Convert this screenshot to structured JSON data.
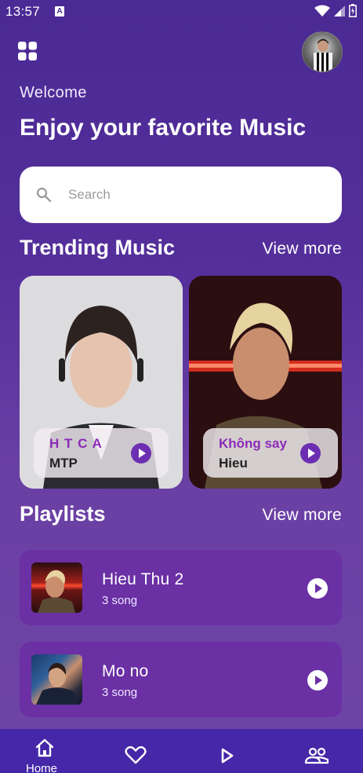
{
  "status_bar": {
    "time": "13:57",
    "notification_glyph": "A"
  },
  "header": {
    "menu_icon": "grid-icon",
    "avatar_icon": "profile-avatar"
  },
  "greeting": {
    "welcome": "Welcome",
    "headline": "Enjoy your favorite Music"
  },
  "search": {
    "placeholder": "Search"
  },
  "trending": {
    "title": "Trending Music",
    "view_more": "View more",
    "cards": [
      {
        "title": "H T C A",
        "artist": "MTP"
      },
      {
        "title": "Không say",
        "artist": "Hieu"
      }
    ]
  },
  "playlists": {
    "title": "Playlists",
    "view_more": "View more",
    "items": [
      {
        "name": "Hieu Thu 2",
        "count": "3 song"
      },
      {
        "name": "Mo no",
        "count": "3 song"
      }
    ]
  },
  "bottom_nav": {
    "items": [
      {
        "label": "Home",
        "icon": "home-icon"
      },
      {
        "label": "",
        "icon": "heart-icon"
      },
      {
        "label": "",
        "icon": "play-icon"
      },
      {
        "label": "",
        "icon": "people-icon"
      }
    ]
  },
  "colors": {
    "accent": "#6d2fb2",
    "card_title": "#8b2bb7",
    "nav_bg": "#4527a8",
    "playlist_bg": "#6a30a4"
  }
}
